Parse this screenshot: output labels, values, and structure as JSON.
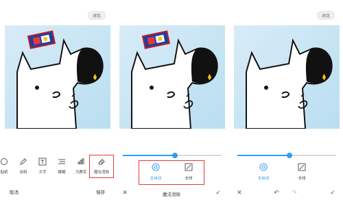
{
  "compare_label": "对比",
  "panel1": {
    "tools": [
      {
        "icon": "partial-tool-icon",
        "label": "贴纸"
      },
      {
        "icon": "brush-icon",
        "label": "涂鸦"
      },
      {
        "icon": "text-icon",
        "label": "文字"
      },
      {
        "icon": "blur-icon",
        "label": "模糊"
      },
      {
        "icon": "mosaic-icon",
        "label": "马赛克"
      },
      {
        "icon": "eraser-icon",
        "label": "魔法消除"
      }
    ],
    "cancel": "取消",
    "save": "保存"
  },
  "panel2": {
    "slider_value": 0.53,
    "modes": [
      {
        "icon": "auto-detect-icon",
        "label": "全自动",
        "active": true
      },
      {
        "icon": "draw-line-icon",
        "label": "去线",
        "active": false
      }
    ],
    "title": "魔法消除"
  },
  "panel3": {
    "slider_value": 0.53,
    "modes": [
      {
        "icon": "auto-detect-icon",
        "label": "全自动",
        "active": true
      },
      {
        "icon": "draw-line-icon",
        "label": "去线",
        "active": false
      }
    ]
  },
  "colors": {
    "accent": "#2f9cf6",
    "highlight": "#e53935",
    "sky_top": "#d8ecf7",
    "sky_bottom": "#b7ddf0"
  }
}
